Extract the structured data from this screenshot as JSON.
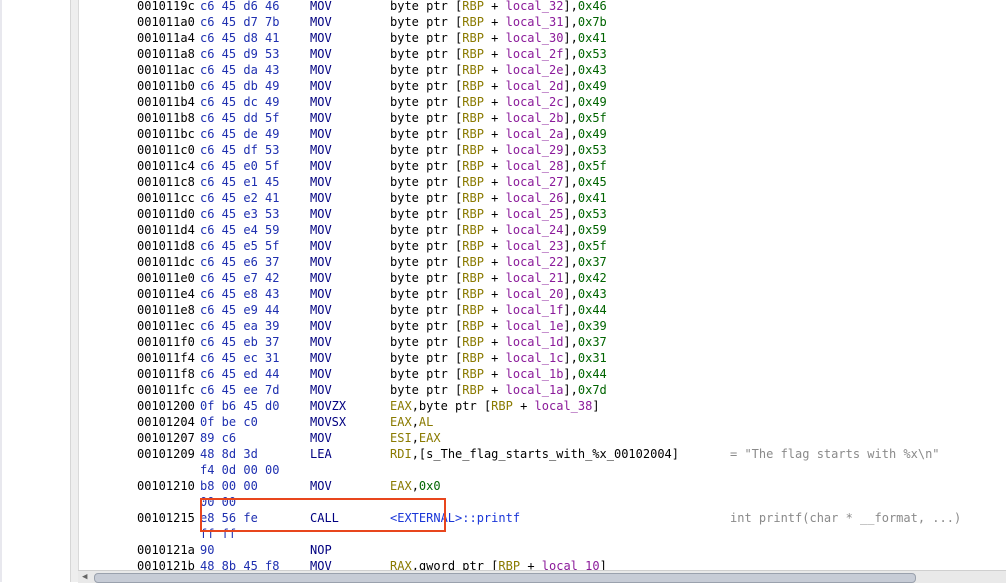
{
  "listing": {
    "rows": [
      {
        "addr": "0010119c",
        "bytes": "c6 45 d6 46",
        "mnemonic": "MOV",
        "operand": {
          "kind": "store",
          "local": "local_32",
          "imm": "0x46"
        }
      },
      {
        "addr": "001011a0",
        "bytes": "c6 45 d7 7b",
        "mnemonic": "MOV",
        "operand": {
          "kind": "store",
          "local": "local_31",
          "imm": "0x7b"
        }
      },
      {
        "addr": "001011a4",
        "bytes": "c6 45 d8 41",
        "mnemonic": "MOV",
        "operand": {
          "kind": "store",
          "local": "local_30",
          "imm": "0x41"
        }
      },
      {
        "addr": "001011a8",
        "bytes": "c6 45 d9 53",
        "mnemonic": "MOV",
        "operand": {
          "kind": "store",
          "local": "local_2f",
          "imm": "0x53"
        }
      },
      {
        "addr": "001011ac",
        "bytes": "c6 45 da 43",
        "mnemonic": "MOV",
        "operand": {
          "kind": "store",
          "local": "local_2e",
          "imm": "0x43"
        }
      },
      {
        "addr": "001011b0",
        "bytes": "c6 45 db 49",
        "mnemonic": "MOV",
        "operand": {
          "kind": "store",
          "local": "local_2d",
          "imm": "0x49"
        }
      },
      {
        "addr": "001011b4",
        "bytes": "c6 45 dc 49",
        "mnemonic": "MOV",
        "operand": {
          "kind": "store",
          "local": "local_2c",
          "imm": "0x49"
        }
      },
      {
        "addr": "001011b8",
        "bytes": "c6 45 dd 5f",
        "mnemonic": "MOV",
        "operand": {
          "kind": "store",
          "local": "local_2b",
          "imm": "0x5f"
        }
      },
      {
        "addr": "001011bc",
        "bytes": "c6 45 de 49",
        "mnemonic": "MOV",
        "operand": {
          "kind": "store",
          "local": "local_2a",
          "imm": "0x49"
        }
      },
      {
        "addr": "001011c0",
        "bytes": "c6 45 df 53",
        "mnemonic": "MOV",
        "operand": {
          "kind": "store",
          "local": "local_29",
          "imm": "0x53"
        }
      },
      {
        "addr": "001011c4",
        "bytes": "c6 45 e0 5f",
        "mnemonic": "MOV",
        "operand": {
          "kind": "store",
          "local": "local_28",
          "imm": "0x5f"
        }
      },
      {
        "addr": "001011c8",
        "bytes": "c6 45 e1 45",
        "mnemonic": "MOV",
        "operand": {
          "kind": "store",
          "local": "local_27",
          "imm": "0x45"
        }
      },
      {
        "addr": "001011cc",
        "bytes": "c6 45 e2 41",
        "mnemonic": "MOV",
        "operand": {
          "kind": "store",
          "local": "local_26",
          "imm": "0x41"
        }
      },
      {
        "addr": "001011d0",
        "bytes": "c6 45 e3 53",
        "mnemonic": "MOV",
        "operand": {
          "kind": "store",
          "local": "local_25",
          "imm": "0x53"
        }
      },
      {
        "addr": "001011d4",
        "bytes": "c6 45 e4 59",
        "mnemonic": "MOV",
        "operand": {
          "kind": "store",
          "local": "local_24",
          "imm": "0x59"
        }
      },
      {
        "addr": "001011d8",
        "bytes": "c6 45 e5 5f",
        "mnemonic": "MOV",
        "operand": {
          "kind": "store",
          "local": "local_23",
          "imm": "0x5f"
        }
      },
      {
        "addr": "001011dc",
        "bytes": "c6 45 e6 37",
        "mnemonic": "MOV",
        "operand": {
          "kind": "store",
          "local": "local_22",
          "imm": "0x37"
        }
      },
      {
        "addr": "001011e0",
        "bytes": "c6 45 e7 42",
        "mnemonic": "MOV",
        "operand": {
          "kind": "store",
          "local": "local_21",
          "imm": "0x42"
        }
      },
      {
        "addr": "001011e4",
        "bytes": "c6 45 e8 43",
        "mnemonic": "MOV",
        "operand": {
          "kind": "store",
          "local": "local_20",
          "imm": "0x43"
        }
      },
      {
        "addr": "001011e8",
        "bytes": "c6 45 e9 44",
        "mnemonic": "MOV",
        "operand": {
          "kind": "store",
          "local": "local_1f",
          "imm": "0x44"
        }
      },
      {
        "addr": "001011ec",
        "bytes": "c6 45 ea 39",
        "mnemonic": "MOV",
        "operand": {
          "kind": "store",
          "local": "local_1e",
          "imm": "0x39"
        }
      },
      {
        "addr": "001011f0",
        "bytes": "c6 45 eb 37",
        "mnemonic": "MOV",
        "operand": {
          "kind": "store",
          "local": "local_1d",
          "imm": "0x37"
        }
      },
      {
        "addr": "001011f4",
        "bytes": "c6 45 ec 31",
        "mnemonic": "MOV",
        "operand": {
          "kind": "store",
          "local": "local_1c",
          "imm": "0x31"
        }
      },
      {
        "addr": "001011f8",
        "bytes": "c6 45 ed 44",
        "mnemonic": "MOV",
        "operand": {
          "kind": "store",
          "local": "local_1b",
          "imm": "0x44"
        }
      },
      {
        "addr": "001011fc",
        "bytes": "c6 45 ee 7d",
        "mnemonic": "MOV",
        "operand": {
          "kind": "store",
          "local": "local_1a",
          "imm": "0x7d"
        }
      },
      {
        "addr": "00101200",
        "bytes": "0f b6 45 d0",
        "mnemonic": "MOVZX",
        "operand": {
          "kind": "load",
          "reg": "EAX",
          "prefix": "byte ptr",
          "local": "local_38"
        }
      },
      {
        "addr": "00101204",
        "bytes": "0f be c0",
        "mnemonic": "MOVSX",
        "operand": {
          "kind": "regs",
          "dst": "EAX",
          "src": "AL"
        }
      },
      {
        "addr": "00101207",
        "bytes": "89 c6",
        "mnemonic": "MOV",
        "operand": {
          "kind": "regs",
          "dst": "ESI",
          "src": "EAX"
        }
      },
      {
        "addr": "00101209",
        "bytes": "48 8d 3d",
        "bytes_cont": "f4 0d 00 00",
        "mnemonic": "LEA",
        "operand": {
          "kind": "lea",
          "reg": "RDI",
          "symbol": "s_The_flag_starts_with_%x_00102004"
        },
        "comment": "= \"The flag starts with %x\\n\""
      },
      {
        "addr": "00101210",
        "bytes": "b8 00 00",
        "bytes_cont": "00 00",
        "mnemonic": "MOV",
        "operand": {
          "kind": "regimm",
          "reg": "EAX",
          "imm": "0x0"
        }
      },
      {
        "addr": "00101215",
        "bytes": "e8 56 fe",
        "bytes_cont": "ff ff",
        "mnemonic": "CALL",
        "operand": {
          "kind": "call",
          "target": "<EXTERNAL>::printf"
        },
        "comment": "int printf(char * __format, ...)"
      },
      {
        "addr": "0010121a",
        "bytes": "90",
        "mnemonic": "NOP",
        "operand": {
          "kind": "none"
        }
      },
      {
        "addr": "0010121b",
        "bytes": "48 8b 45 f8",
        "mnemonic": "MOV",
        "operand": {
          "kind": "load",
          "reg": "RAX",
          "prefix": "qword ptr",
          "local": "local_10"
        }
      }
    ],
    "tokens": {
      "byte_ptr": "byte ptr",
      "base": "RBP",
      "plus": " + "
    }
  },
  "colors": {
    "highlight_box": "#e8461d",
    "address": "#000000",
    "bytes": "#1e2fb0",
    "mnemonic": "#000080",
    "register": "#8a7a00",
    "local_var": "#8b1a9a",
    "hex_immediate": "#006400",
    "external_symbol": "#1a36d8",
    "comment": "#8a8a8a"
  }
}
